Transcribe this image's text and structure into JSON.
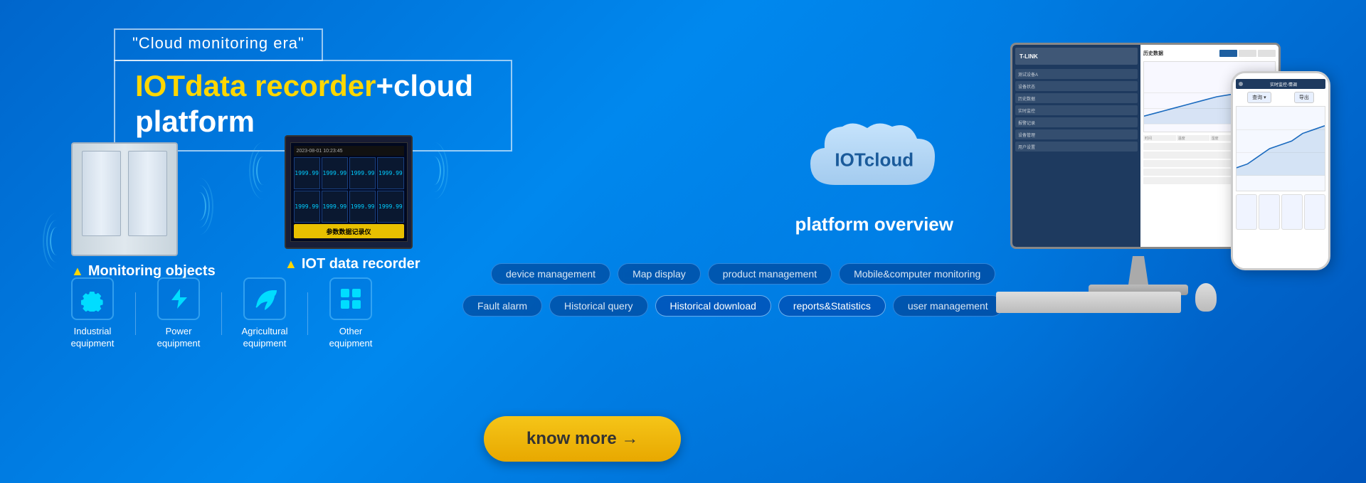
{
  "banner": {
    "background_color": "#0066cc",
    "cloud_era_label": "\"Cloud monitoring era\"",
    "main_title_highlight": "IOTdata recorder",
    "main_title_normal": "+cloud platform",
    "monitoring_section": {
      "label": "Monitoring objects",
      "warning_prefix": "▲"
    },
    "iot_section": {
      "label": "IOT data recorder",
      "warning_prefix": "▲"
    },
    "cloud_section": {
      "cloud_label": "IOTcloud",
      "platform_label": "platform overview"
    },
    "icons": [
      {
        "id": "industrial",
        "label": "Industrial\nequipment",
        "icon_type": "gear"
      },
      {
        "id": "power",
        "label": "Power\nequipment",
        "icon_type": "bolt"
      },
      {
        "id": "agricultural",
        "label": "Agricultural\nequipment",
        "icon_type": "leaf"
      },
      {
        "id": "other",
        "label": "Other\nequipment",
        "icon_type": "grid"
      }
    ],
    "feature_tags_row1": [
      "device management",
      "Map display",
      "product management",
      "Mobile&computer monitoring"
    ],
    "feature_tags_row2": [
      "Fault alarm",
      "Historical query",
      "Historical download",
      "reports&Statistics",
      "user management"
    ],
    "know_more_button": "know more →",
    "accent_color": "#FFD700"
  }
}
